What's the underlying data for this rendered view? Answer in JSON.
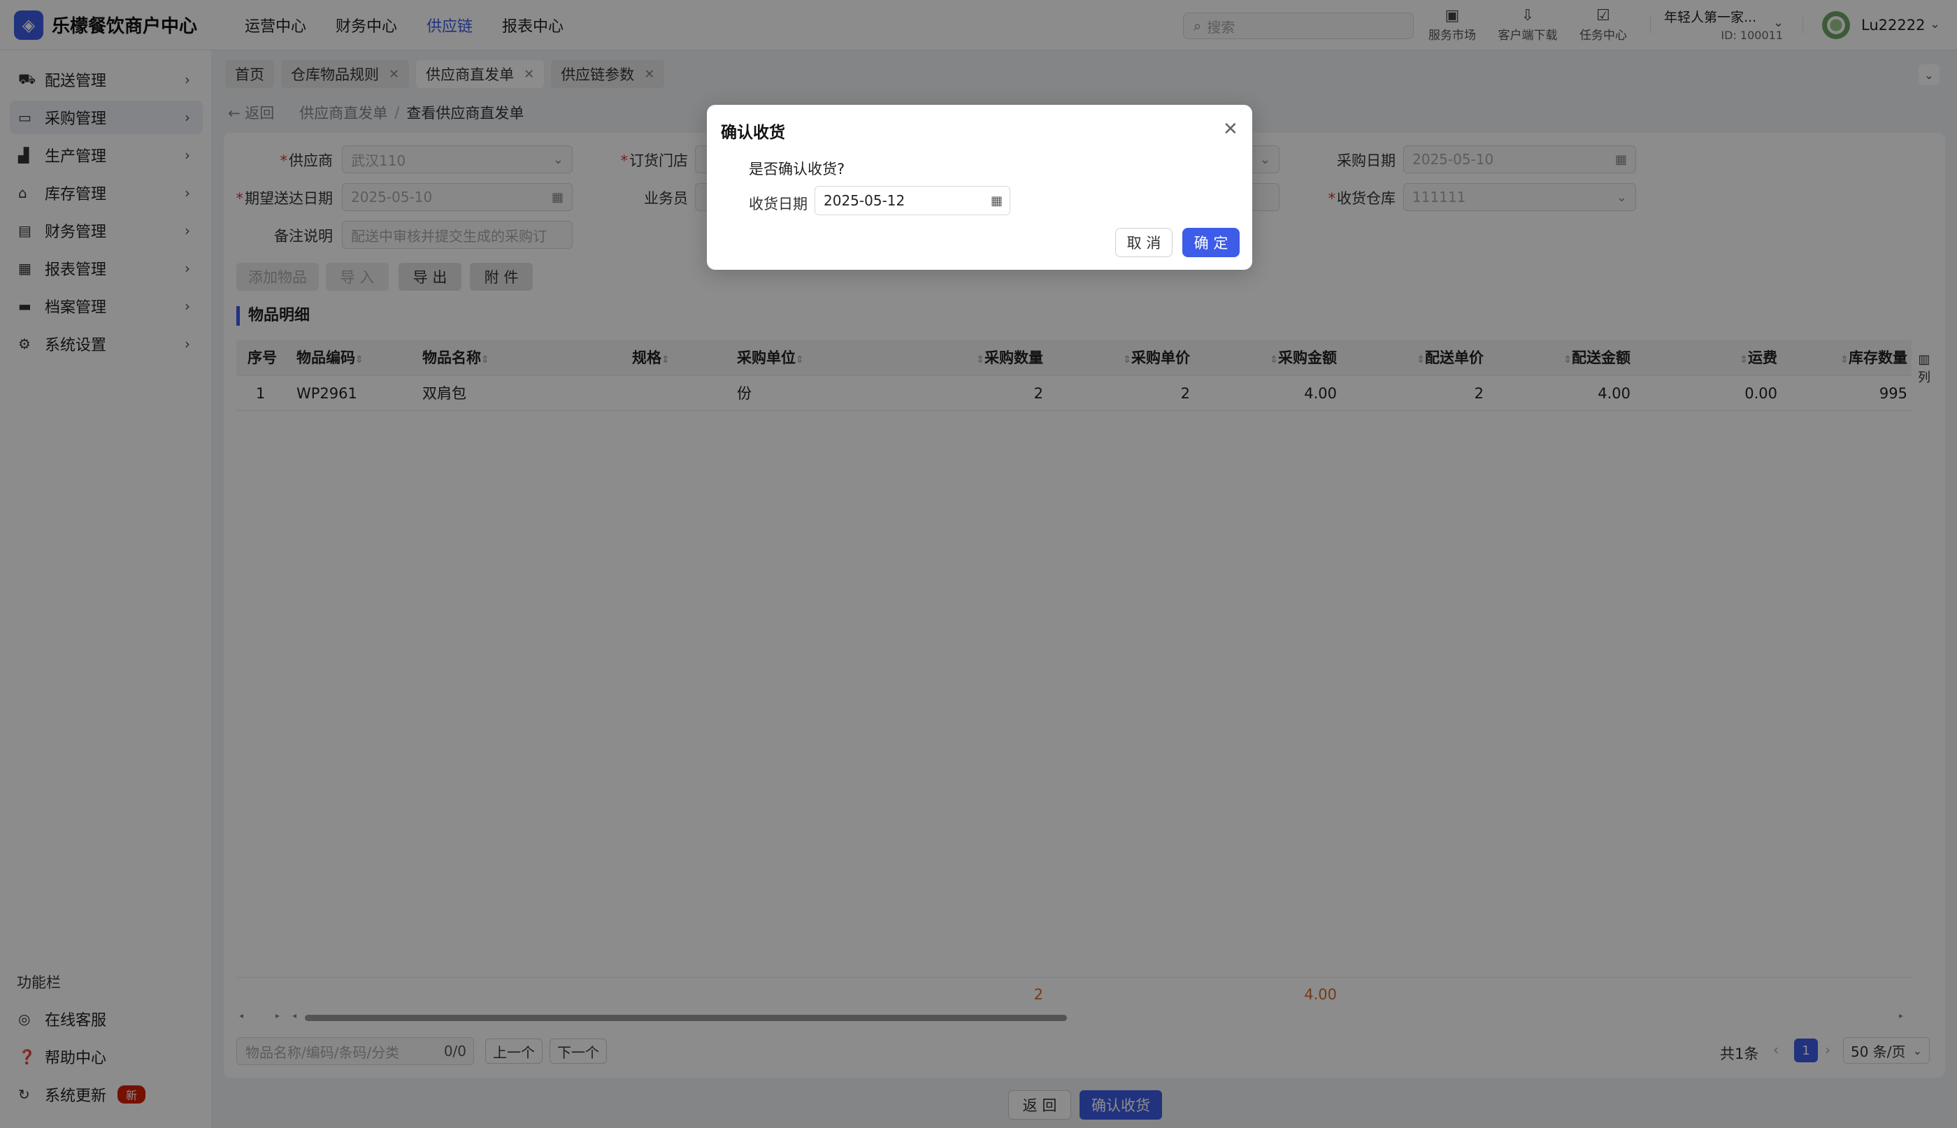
{
  "app": {
    "title": "乐檬餐饮商户中心"
  },
  "topnav": [
    "运营中心",
    "财务中心",
    "供应链",
    "报表中心"
  ],
  "header": {
    "search_placeholder": "搜索",
    "tools": [
      {
        "label": "服务市场",
        "icon": "store-icon"
      },
      {
        "label": "客户端下载",
        "icon": "download-icon"
      },
      {
        "label": "任务中心",
        "icon": "task-icon"
      }
    ],
    "account_name": "年轻人第一家...",
    "account_id": "ID: 100011",
    "user": "Lu22222"
  },
  "sidebar": {
    "items": [
      {
        "label": "配送管理",
        "icon": "truck-icon"
      },
      {
        "label": "采购管理",
        "icon": "inbox-icon"
      },
      {
        "label": "生产管理",
        "icon": "chart-icon"
      },
      {
        "label": "库存管理",
        "icon": "warehouse-icon"
      },
      {
        "label": "财务管理",
        "icon": "ledger-icon"
      },
      {
        "label": "报表管理",
        "icon": "report-icon"
      },
      {
        "label": "档案管理",
        "icon": "archive-icon"
      },
      {
        "label": "系统设置",
        "icon": "gear-icon"
      }
    ],
    "func_title": "功能栏",
    "func_items": [
      {
        "label": "在线客服",
        "icon": "headset-icon"
      },
      {
        "label": "帮助中心",
        "icon": "help-icon"
      },
      {
        "label": "系统更新",
        "icon": "refresh-icon",
        "badge": "新"
      }
    ]
  },
  "tabs": [
    {
      "label": "首页",
      "closable": false
    },
    {
      "label": "仓库物品规则",
      "closable": true
    },
    {
      "label": "供应商直发单",
      "closable": true
    },
    {
      "label": "供应链参数",
      "closable": true
    }
  ],
  "breadcrumb": {
    "back": "返回",
    "parent": "供应商直发单",
    "current": "查看供应商直发单"
  },
  "form": {
    "supplier_label": "供应商",
    "supplier_value": "武汉110",
    "store_label": "订货门店",
    "purchase_date_label": "采购日期",
    "purchase_date_value": "2025-05-10",
    "expected_date_label": "期望送达日期",
    "expected_date_value": "2025-05-10",
    "salesman_label": "业务员",
    "warehouse_label": "收货仓库",
    "warehouse_value": "111111",
    "remark_label": "备注说明",
    "remark_value": "配送中审核并提交生成的采购订"
  },
  "actions": {
    "add_item": "添加物品",
    "import": "导 入",
    "export": "导 出",
    "attach": "附 件"
  },
  "section_title": "物品明细",
  "table": {
    "columns": [
      "序号",
      "物品编码",
      "物品名称",
      "规格",
      "采购单位",
      "采购数量",
      "采购单价",
      "采购金额",
      "配送单价",
      "配送金额",
      "运费",
      "库存数量"
    ],
    "rows": [
      [
        "1",
        "WP2961",
        "双肩包",
        "",
        "份",
        "2",
        "2",
        "4.00",
        "2",
        "4.00",
        "0.00",
        "995"
      ]
    ],
    "column_setting": "列",
    "summary": {
      "qty": "2",
      "amount": "4.00"
    }
  },
  "bottom": {
    "find_placeholder": "物品名称/编码/条码/分类",
    "find_count": "0/0",
    "prev": "上一个",
    "next": "下一个",
    "total": "共1条",
    "page": "1",
    "page_size": "50 条/页"
  },
  "footer": {
    "back": "返 回",
    "confirm": "确认收货"
  },
  "modal": {
    "title": "确认收货",
    "question": "是否确认收货?",
    "date_label": "收货日期",
    "date_value": "2025-05-12",
    "cancel": "取 消",
    "ok": "确 定"
  },
  "colors": {
    "primary": "#3d5ce8",
    "required": "#d9363e",
    "summary": "#d66a2b",
    "badge": "#d81e06"
  }
}
